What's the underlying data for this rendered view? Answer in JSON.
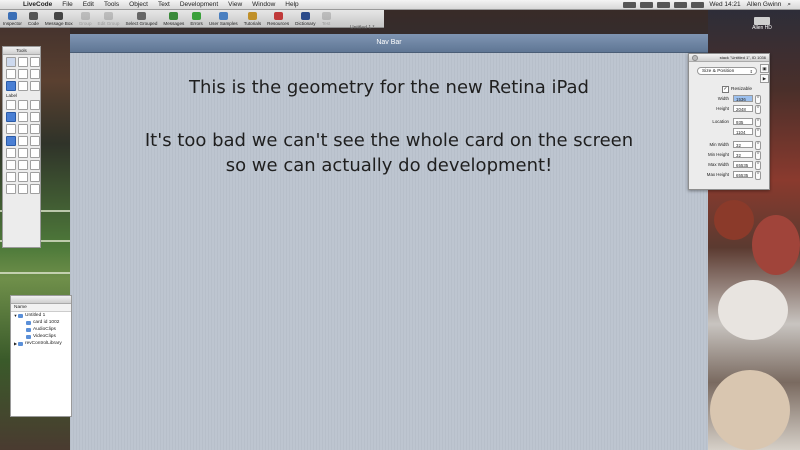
{
  "menubar": {
    "app": "LiveCode",
    "items": [
      "File",
      "Edit",
      "Tools",
      "Object",
      "Text",
      "Development",
      "View",
      "Window",
      "Help"
    ],
    "clock": "Wed 14:21",
    "user": "Allen Gwinn"
  },
  "toolbar": {
    "buttons": [
      {
        "label": "Inspector",
        "icon": "inspector-icon",
        "color": "#3b6fb6",
        "disabled": false
      },
      {
        "label": "Code",
        "icon": "code-icon",
        "color": "#555555",
        "disabled": false
      },
      {
        "label": "Message Box",
        "icon": "message-box-icon",
        "color": "#444444",
        "disabled": false
      },
      {
        "label": "Group",
        "icon": "group-icon",
        "color": "#888888",
        "disabled": true
      },
      {
        "label": "Edit Group",
        "icon": "edit-group-icon",
        "color": "#888888",
        "disabled": true
      },
      {
        "label": "Select Grouped",
        "icon": "select-grouped-icon",
        "color": "#666666",
        "disabled": false
      },
      {
        "label": "Messages",
        "icon": "messages-icon",
        "color": "#3a8a3a",
        "disabled": false
      },
      {
        "label": "Errors",
        "icon": "errors-icon",
        "color": "#3aa03a",
        "disabled": false
      },
      {
        "label": "User Samples",
        "icon": "user-samples-icon",
        "color": "#4a7fc0",
        "disabled": false
      },
      {
        "label": "Tutorials",
        "icon": "tutorials-icon",
        "color": "#c0902a",
        "disabled": false
      },
      {
        "label": "Resources",
        "icon": "resources-icon",
        "color": "#c03a3a",
        "disabled": false
      },
      {
        "label": "Dictionary",
        "icon": "dictionary-icon",
        "color": "#2a4a8a",
        "disabled": false
      },
      {
        "label": "Test",
        "icon": "test-icon",
        "color": "#888888",
        "disabled": true
      }
    ],
    "window_title": "Untitled 1 *"
  },
  "tools_palette": {
    "title": "Tools",
    "label_tool": "Label"
  },
  "stack": {
    "nav_bar_title": "Nav Bar",
    "line1": "This is the geometry for the new Retina iPad",
    "line2": "It's too bad we can't see the whole card on the screen",
    "line3": "so we can actually do development!"
  },
  "inspector": {
    "title": "stack \"Untitled 1\", ID 1036",
    "section": "Size & Position",
    "resizable_label": "Resizable",
    "resizable_checked": true,
    "fields": [
      {
        "label": "Width",
        "value": "1536",
        "highlight": true
      },
      {
        "label": "Height",
        "value": "2048",
        "highlight": false
      },
      {
        "label": "Location",
        "value": "935",
        "highlight": false
      },
      {
        "label": "",
        "value": "1104",
        "highlight": false
      },
      {
        "label": "Min Width",
        "value": "32",
        "highlight": false
      },
      {
        "label": "Min Height",
        "value": "32",
        "highlight": false
      },
      {
        "label": "Max Width",
        "value": "65535",
        "highlight": false
      },
      {
        "label": "Max Height",
        "value": "65535",
        "highlight": false
      }
    ]
  },
  "desktop": {
    "drive_label": "Allen HD"
  },
  "project_browser": {
    "header": "Name",
    "rows": [
      {
        "label": "Untitled 1",
        "depth": 0,
        "expanded": true
      },
      {
        "label": "card id 1002",
        "depth": 1,
        "expanded": false
      },
      {
        "label": "AudioClips",
        "depth": 1,
        "expanded": false
      },
      {
        "label": "VideoClips",
        "depth": 1,
        "expanded": false
      },
      {
        "label": "revControlLibrary",
        "depth": 0,
        "expanded": false
      }
    ]
  }
}
